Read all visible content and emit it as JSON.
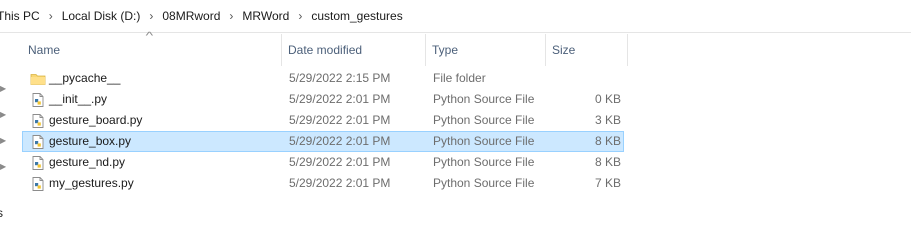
{
  "breadcrumb": {
    "items": [
      "This PC",
      "Local Disk (D:)",
      "08MRword",
      "MRWord",
      "custom_gestures"
    ],
    "separator": "›"
  },
  "columns": {
    "name": "Name",
    "date": "Date modified",
    "type": "Type",
    "size": "Size"
  },
  "navpane": {
    "partial_label": "s"
  },
  "files": [
    {
      "name": "__pycache__",
      "date": "5/29/2022 2:15 PM",
      "type": "File folder",
      "size": "",
      "icon": "folder-icon",
      "selected": false
    },
    {
      "name": "__init__.py",
      "date": "5/29/2022 2:01 PM",
      "type": "Python Source File",
      "size": "0 KB",
      "icon": "python-file-icon",
      "selected": false
    },
    {
      "name": "gesture_board.py",
      "date": "5/29/2022 2:01 PM",
      "type": "Python Source File",
      "size": "3 KB",
      "icon": "python-file-icon",
      "selected": false
    },
    {
      "name": "gesture_box.py",
      "date": "5/29/2022 2:01 PM",
      "type": "Python Source File",
      "size": "8 KB",
      "icon": "python-file-icon",
      "selected": true
    },
    {
      "name": "gesture_nd.py",
      "date": "5/29/2022 2:01 PM",
      "type": "Python Source File",
      "size": "8 KB",
      "icon": "python-file-icon",
      "selected": false
    },
    {
      "name": "my_gestures.py",
      "date": "5/29/2022 2:01 PM",
      "type": "Python Source File",
      "size": "7 KB",
      "icon": "python-file-icon",
      "selected": false
    }
  ],
  "colors": {
    "selection_bg": "#cce8ff",
    "selection_border": "#99d1ff",
    "folder": "#f8d775",
    "header_text": "#4c607a"
  }
}
